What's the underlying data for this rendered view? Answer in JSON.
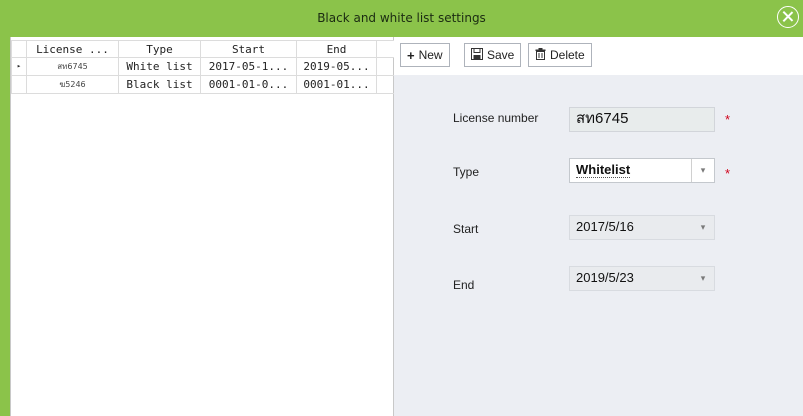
{
  "window": {
    "title": "Black and white list settings"
  },
  "grid": {
    "columns": [
      "License ...",
      "Type",
      "Start",
      "End"
    ],
    "rows": [
      {
        "indicator": "▸",
        "license": "สท6745",
        "type": "White list",
        "start": "2017-05-1...",
        "end": "2019-05..."
      },
      {
        "indicator": "",
        "license": "ฆ5246",
        "type": "Black list",
        "start": "0001-01-0...",
        "end": "0001-01..."
      }
    ]
  },
  "toolbar": {
    "new_label": "New",
    "save_label": "Save",
    "delete_label": "Delete"
  },
  "form": {
    "license_label": "License number",
    "license_value": "สท6745",
    "type_label": "Type",
    "type_value": "Whitelist",
    "start_label": "Start",
    "start_value": "2017/5/16",
    "end_label": "End",
    "end_value": "2019/5/23",
    "required_mark": "*"
  },
  "colors": {
    "titlebar": "#8bc34a",
    "panel": "#eceef3",
    "required": "#d0021b"
  },
  "icons": {
    "close": "close-icon",
    "new": "plus-icon",
    "save": "save-icon",
    "delete": "trash-icon",
    "dropdown": "chevron-down-icon",
    "row_indicator": "row-pointer-icon"
  }
}
